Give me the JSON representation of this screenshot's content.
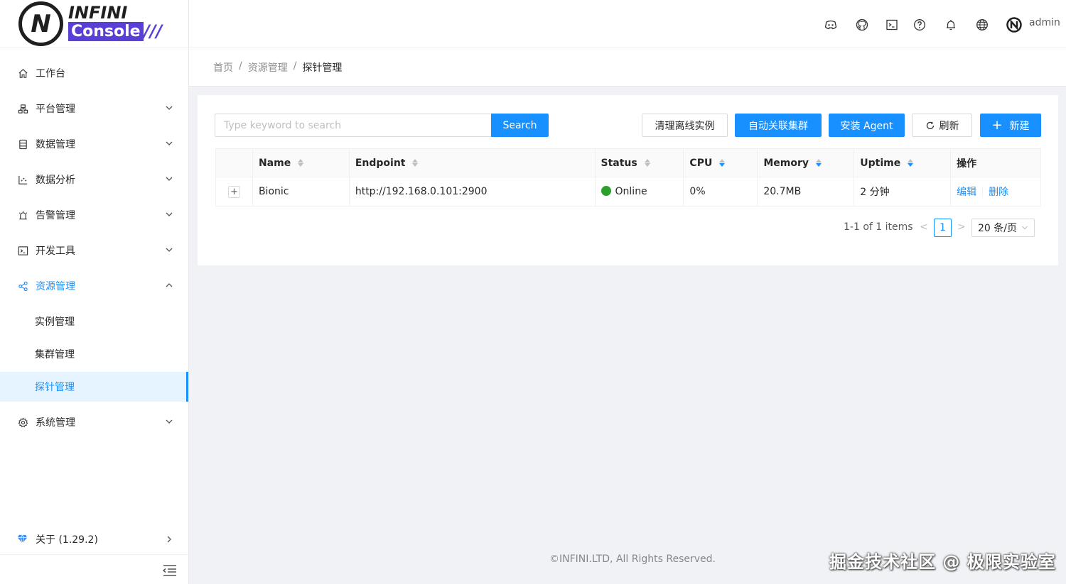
{
  "logo": {
    "mark": "N",
    "infini": "INFINI",
    "console": "Console",
    "slashes": "///"
  },
  "sidebar": {
    "items": [
      {
        "label": "工作台",
        "icon": "home-icon"
      },
      {
        "label": "平台管理",
        "icon": "cluster-icon"
      },
      {
        "label": "数据管理",
        "icon": "database-icon"
      },
      {
        "label": "数据分析",
        "icon": "chart-icon"
      },
      {
        "label": "告警管理",
        "icon": "alarm-icon"
      },
      {
        "label": "开发工具",
        "icon": "terminal-icon"
      },
      {
        "label": "资源管理",
        "icon": "share-icon"
      },
      {
        "label": "系统管理",
        "icon": "gear-icon"
      }
    ],
    "subitems": [
      {
        "label": "实例管理"
      },
      {
        "label": "集群管理"
      },
      {
        "label": "探针管理"
      }
    ],
    "about": "关于 (1.29.2)"
  },
  "header": {
    "icons": [
      "discord-icon",
      "github-icon",
      "terminal-icon",
      "help-icon",
      "bell-icon",
      "globe-icon"
    ],
    "user": "admin"
  },
  "breadcrumb": {
    "home": "首页",
    "parent": "资源管理",
    "current": "探针管理",
    "sep": "/"
  },
  "toolbar": {
    "search_placeholder": "Type keyword to search",
    "search_label": "Search",
    "clean_label": "清理离线实例",
    "auto_assoc_label": "自动关联集群",
    "install_label": "安装 Agent",
    "refresh_label": "刷新",
    "new_label": "新建",
    "new_prefix": "+"
  },
  "table": {
    "columns": [
      "Name",
      "Endpoint",
      "Status",
      "CPU",
      "Memory",
      "Uptime",
      "操作"
    ],
    "rows": [
      {
        "expand": "+",
        "name": "Bionic",
        "endpoint": "http://192.168.0.101:2900",
        "status": "Online",
        "cpu": "0%",
        "memory": "20.7MB",
        "uptime": "2 分钟",
        "edit": "编辑",
        "delete": "删除"
      }
    ]
  },
  "pagination": {
    "total": "1-1 of 1 items",
    "prev": "<",
    "page": "1",
    "next": ">",
    "size": "20 条/页"
  },
  "footer": "©INFINI.LTD, All Rights Reserved.",
  "watermark": "掘金技术社区 @ 极限实验室",
  "colors": {
    "primary": "#1890ff",
    "online": "#2ca02c",
    "brand": "#5a3fd6"
  }
}
